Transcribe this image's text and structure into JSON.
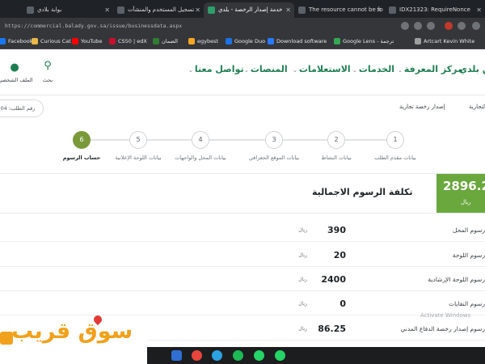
{
  "browser": {
    "tabs": [
      {
        "title": "بوابة بلادي",
        "active": false
      },
      {
        "title": "تسجيل المستخدم والمنشآت",
        "active": false
      },
      {
        "title": "خدمة إصدار الرخصة - بلدي",
        "active": true
      },
      {
        "title": "The resource cannot be fo",
        "active": false
      },
      {
        "title": "IDX21323: RequireNonce",
        "active": false
      }
    ],
    "url": "https://commercial.balady.gov.sa/issue/businessdata.aspx",
    "bookmarks": [
      {
        "label": "Facebook",
        "color": "#1877f2"
      },
      {
        "label": "Curious Cat",
        "color": "#e9b64a"
      },
      {
        "label": "YouTube",
        "color": "#ff0000"
      },
      {
        "label": "CS50 | edX",
        "color": "#c8102e"
      },
      {
        "label": "الضمان",
        "color": "#2e7d32"
      },
      {
        "label": "egybest",
        "color": "#f5a623"
      },
      {
        "label": "Google Duo",
        "color": "#1a73e8"
      },
      {
        "label": "Download software",
        "color": "#2979ff"
      },
      {
        "label": "Google Lens - ترجمة",
        "color": "#34a853"
      },
      {
        "label": "Artcart Kevin White",
        "color": "#9e9e9e"
      }
    ]
  },
  "header": {
    "search_label": "بحث",
    "profile_label": "الملف الشخصي",
    "nav": [
      {
        "label": "عن بلدي"
      },
      {
        "label": "مركز المعرفة"
      },
      {
        "label": "الخدمات"
      },
      {
        "label": "الاستعلامات"
      },
      {
        "label": "المنصات"
      },
      {
        "label": "تواصل معنا"
      }
    ]
  },
  "breadcrumb": {
    "order_number": "رقم الطلب: 04",
    "items": [
      "الرخص التجارية",
      "إصدار رخصة تجارية"
    ]
  },
  "stepper": {
    "steps": [
      {
        "number": "1",
        "label": "بيانات مقدم الطلب",
        "active": false
      },
      {
        "number": "2",
        "label": "بيانات النشاط",
        "active": false
      },
      {
        "number": "3",
        "label": "بيانات الموقع الجغرافي",
        "active": false
      },
      {
        "number": "4",
        "label": "بيانات المحل والواجهات",
        "active": false
      },
      {
        "number": "5",
        "label": "بيانات اللوحة الإعلانية",
        "active": false
      },
      {
        "number": "6",
        "label": "حساب الرسوم",
        "active": true
      }
    ]
  },
  "fees": {
    "total_title": "تكلفة الرسوم الاجمالية",
    "total_amount": "2896.25",
    "total_currency": "ريال",
    "rows": [
      {
        "label": "رسوم المحل",
        "value": "390",
        "currency": "ريال"
      },
      {
        "label": "رسوم اللوحة",
        "value": "20",
        "currency": "ريال"
      },
      {
        "label": "رسوم اللوحة الإرشادية",
        "value": "2400",
        "currency": "ريال"
      },
      {
        "label": "رسوم النفايات",
        "value": "0",
        "currency": "ريال"
      },
      {
        "label": "رسوم إصدار رخصة الدفاع المدني",
        "value": "86.25",
        "currency": "ريال"
      }
    ]
  },
  "watermark": {
    "logo_text": "سوق قريب",
    "activate_text": "Activate Windows"
  },
  "colors": {
    "brand_green": "#1e7e52",
    "step_active": "#7a9a3a",
    "total_box": "#6aa83e",
    "logo_orange": "#f2a11c"
  }
}
